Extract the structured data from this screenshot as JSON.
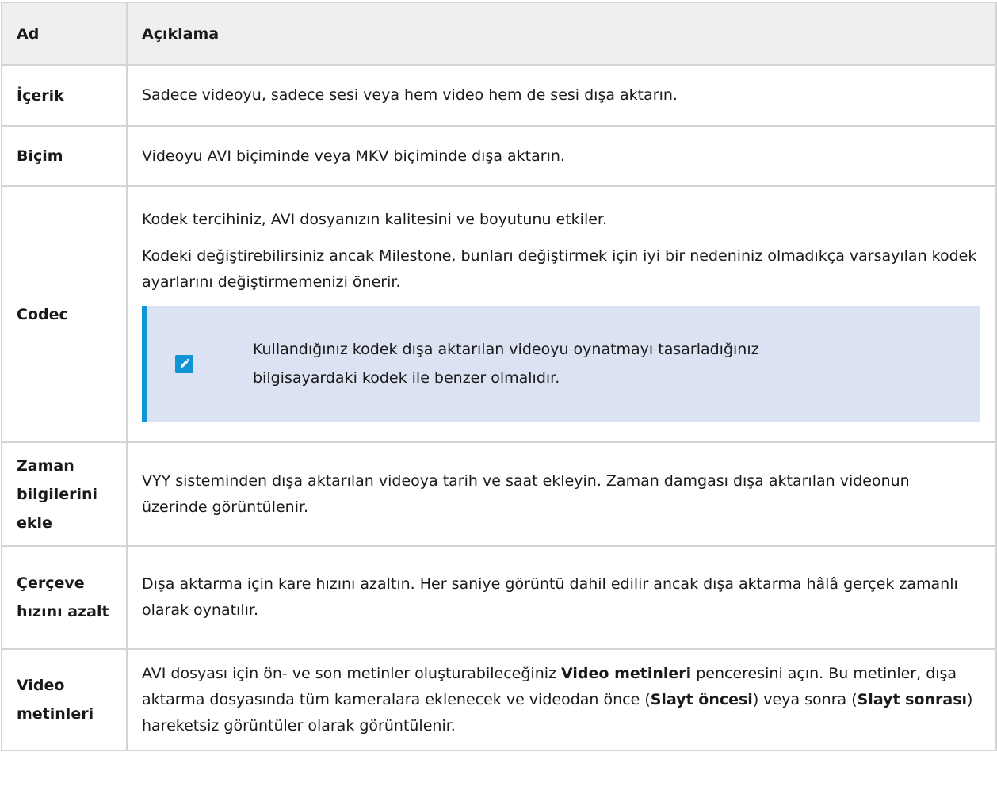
{
  "table": {
    "headers": {
      "name": "Ad",
      "description": "Açıklama"
    },
    "rows": [
      {
        "name": "İçerik",
        "description": "Sadece videoyu, sadece sesi veya hem video hem de sesi dışa aktarın."
      },
      {
        "name": "Biçim",
        "description": "Videoyu AVI biçiminde veya MKV biçiminde dışa aktarın."
      },
      {
        "name": "Codec",
        "paragraph1": "Kodek tercihiniz, AVI dosyanızın kalitesini ve boyutunu etkiler.",
        "paragraph2": "Kodeki değiştirebilirsiniz ancak Milestone, bunları değiştirmek için iyi bir nedeniniz olmadıkça varsayılan kodek ayarlarını değiştirmemenizi önerir.",
        "note": "Kullandığınız kodek dışa aktarılan videoyu oynatmayı tasarladığınız bilgisayardaki kodek ile benzer olmalıdır.",
        "note_icon": "pencil-edit-icon"
      },
      {
        "name": "Zaman bilgilerini ekle",
        "description": "VYY sisteminden dışa aktarılan videoya tarih ve saat ekleyin. Zaman damgası dışa aktarılan videonun üzerinde görüntülenir."
      },
      {
        "name": "Çerçeve hızını azalt",
        "description": "Dışa aktarma için kare hızını azaltın. Her saniye görüntü dahil edilir ancak dışa aktarma hâlâ gerçek zamanlı olarak oynatılır."
      },
      {
        "name": "Video metinleri",
        "desc_part1": "AVI dosyası için ön- ve son metinler oluşturabileceğiniz ",
        "desc_bold1": "Video metinleri",
        "desc_part2": " penceresini açın. Bu metinler, dışa aktarma dosyasında tüm kameralara eklenecek ve videodan önce (",
        "desc_bold2": "Slayt öncesi",
        "desc_part3": ") veya sonra (",
        "desc_bold3": "Slayt sonrası",
        "desc_part4": ") hareketsiz görüntüler olarak görüntülenir."
      }
    ]
  },
  "colors": {
    "header_bg": "#efefef",
    "border": "#d4d4d4",
    "note_bg": "#dbe2f1",
    "note_accent": "#1094d5"
  }
}
